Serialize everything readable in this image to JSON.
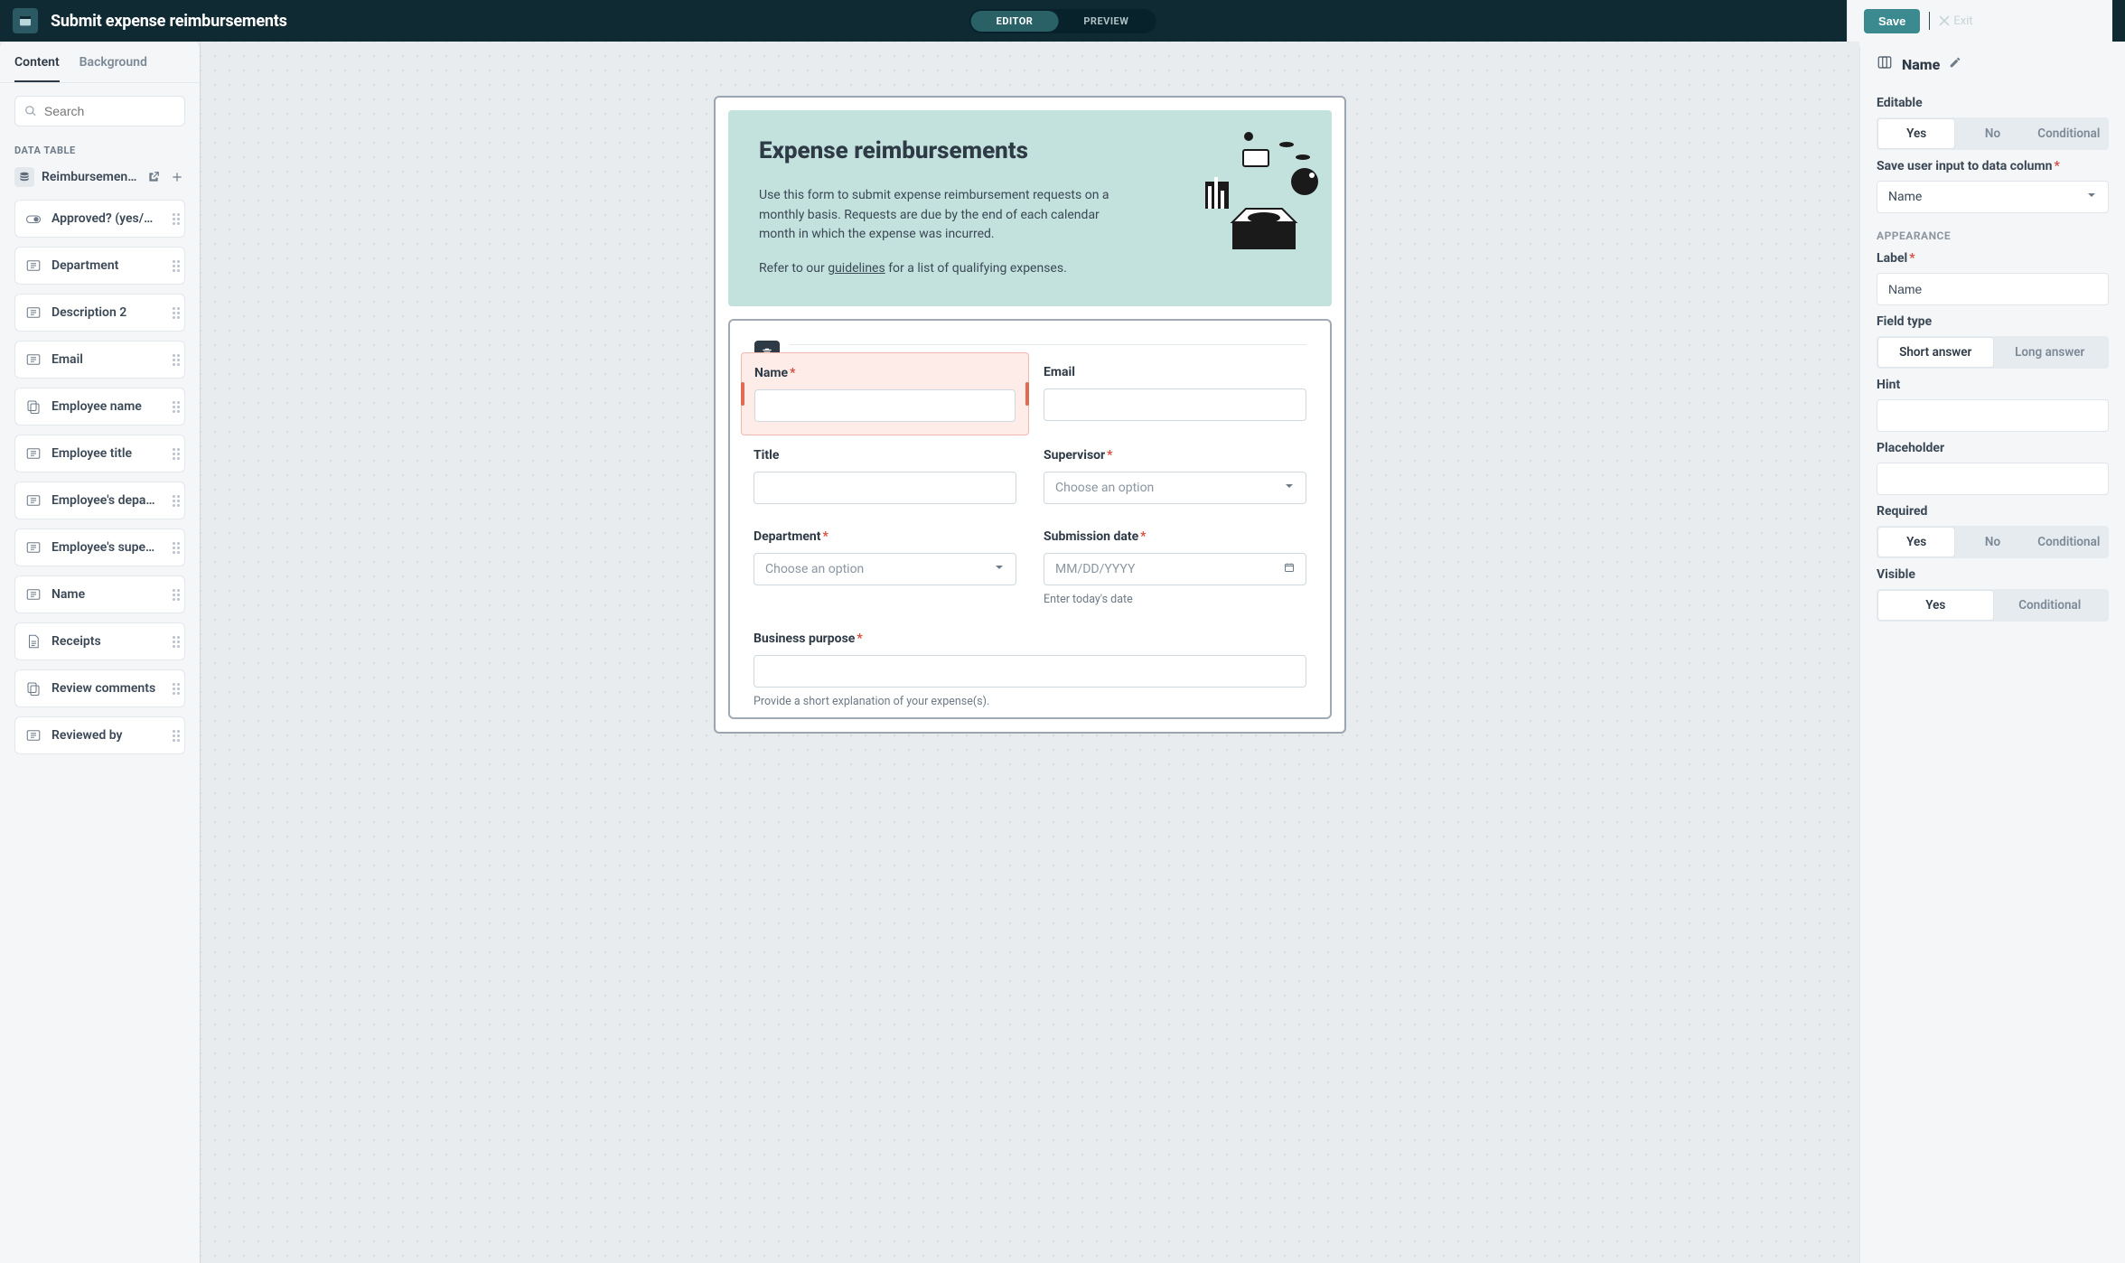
{
  "topbar": {
    "title": "Submit expense reimbursements",
    "mode_editor": "EDITOR",
    "mode_preview": "PREVIEW",
    "save": "Save",
    "exit": "Exit"
  },
  "left": {
    "tab_content": "Content",
    "tab_background": "Background",
    "search_placeholder": "Search",
    "section_data_table": "DATA TABLE",
    "data_table_name": "Reimbursement …",
    "items": [
      {
        "icon": "toggle",
        "label": "Approved? (yes/…"
      },
      {
        "icon": "text",
        "label": "Department"
      },
      {
        "icon": "text",
        "label": "Description 2"
      },
      {
        "icon": "text",
        "label": "Email"
      },
      {
        "icon": "copy",
        "label": "Employee name"
      },
      {
        "icon": "text",
        "label": "Employee title"
      },
      {
        "icon": "text",
        "label": "Employee's depa…"
      },
      {
        "icon": "text",
        "label": "Employee's supe…"
      },
      {
        "icon": "text",
        "label": "Name"
      },
      {
        "icon": "doc",
        "label": "Receipts"
      },
      {
        "icon": "copy",
        "label": "Review comments"
      },
      {
        "icon": "text",
        "label": "Reviewed by"
      }
    ]
  },
  "form": {
    "hero_title": "Expense reimbursements",
    "hero_p1": "Use this form to submit expense reimbursement requests on a monthly basis. Requests are due by the end of each calendar month in which the expense was incurred.",
    "hero_p2_a": "Refer to our ",
    "hero_p2_link": "guidelines",
    "hero_p2_b": " for a list of qualifying expenses.",
    "name_label": "Name",
    "email_label": "Email",
    "title_label": "Title",
    "supervisor_label": "Supervisor",
    "supervisor_ph": "Choose an option",
    "department_label": "Department",
    "department_ph": "Choose an option",
    "subdate_label": "Submission date",
    "subdate_ph": "MM/DD/YYYY",
    "subdate_hint": "Enter today's date",
    "purpose_label": "Business purpose",
    "purpose_hint": "Provide a short explanation of your expense(s)."
  },
  "right": {
    "title": "Name",
    "editable_label": "Editable",
    "yes": "Yes",
    "no": "No",
    "conditional": "Conditional",
    "save_col_label": "Save user input to data column",
    "save_col_value": "Name",
    "appearance": "APPEARANCE",
    "label_label": "Label",
    "label_value": "Name",
    "fieldtype_label": "Field type",
    "short_answer": "Short answer",
    "long_answer": "Long answer",
    "hint_label": "Hint",
    "placeholder_label": "Placeholder",
    "required_label": "Required",
    "visible_label": "Visible"
  }
}
